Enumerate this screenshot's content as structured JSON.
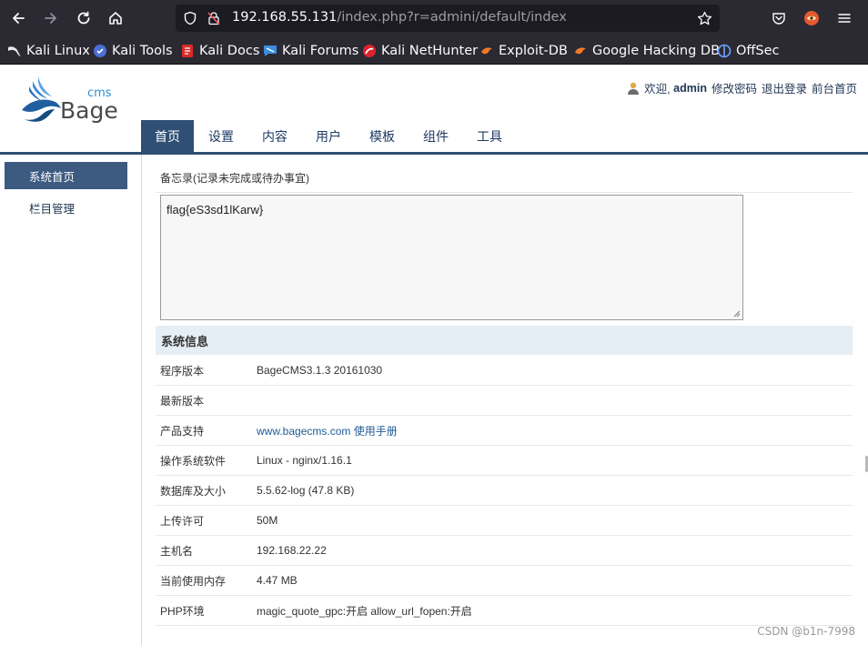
{
  "browser": {
    "url_host": "192.168.55.131",
    "url_path": "/index.php?r=admini/default/index",
    "bookmarks": [
      "Kali Linux",
      "Kali Tools",
      "Kali Docs",
      "Kali Forums",
      "Kali NetHunter",
      "Exploit-DB",
      "Google Hacking DB",
      "OffSec"
    ]
  },
  "header": {
    "logo_small": "cms",
    "logo_big": "Bage",
    "welcome": "欢迎,",
    "username": "admin",
    "links": [
      "修改密码",
      "退出登录",
      "前台首页"
    ]
  },
  "tabs": [
    "首页",
    "设置",
    "内容",
    "用户",
    "模板",
    "组件",
    "工具"
  ],
  "sidebar": {
    "items": [
      "系统首页",
      "栏目管理"
    ]
  },
  "memo": {
    "title": "备忘录(记录未完成或待办事宜)",
    "content": "flag{eS3sd1lKarw}"
  },
  "system_info": {
    "title": "系统信息",
    "rows": [
      {
        "key": "程序版本",
        "value": "BageCMS3.1.3 20161030"
      },
      {
        "key": "最新版本",
        "value": ""
      },
      {
        "key": "产品支持",
        "value": "www.bagecms.com 使用手册"
      },
      {
        "key": "操作系统软件",
        "value": "Linux - nginx/1.16.1"
      },
      {
        "key": "数据库及大小",
        "value": "5.5.62-log (47.8 KB)"
      },
      {
        "key": "上传许可",
        "value": "50M"
      },
      {
        "key": "主机名",
        "value": "192.168.22.22"
      },
      {
        "key": "当前使用内存",
        "value": "4.47 MB"
      },
      {
        "key": "PHP环境",
        "value": "magic_quote_gpc:开启 allow_url_fopen:开启"
      }
    ]
  },
  "watermark": "CSDN @b1n-7998",
  "colors": {
    "nav_blue": "#2f4f74",
    "browser_bg": "#2b2a33"
  }
}
